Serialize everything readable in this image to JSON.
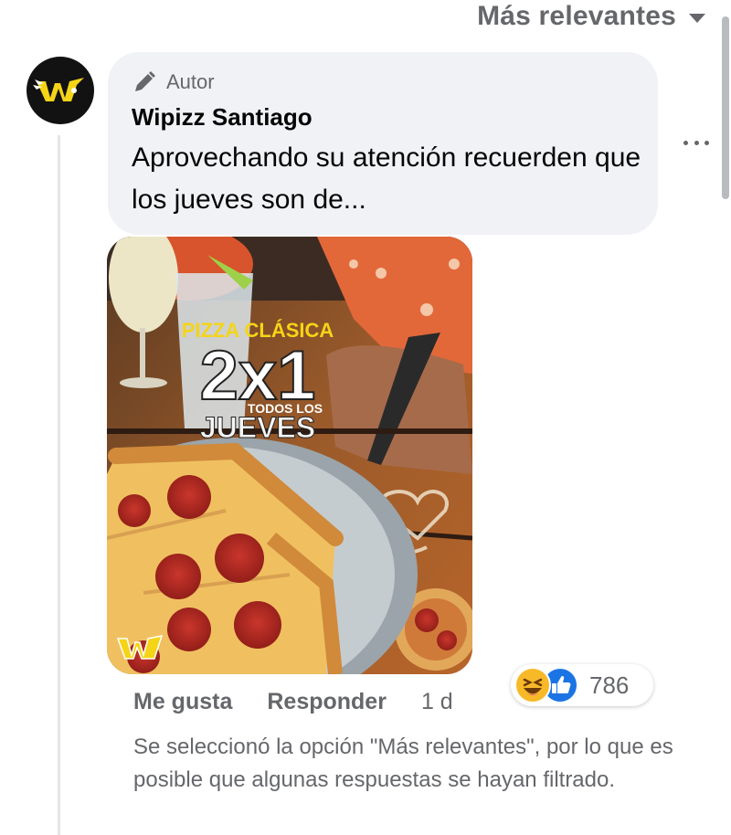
{
  "sort": {
    "label": "Más relevantes",
    "icon": "caret-down-icon"
  },
  "comment": {
    "avatar_icon": "wipizz-logo-icon",
    "author_badge": "Autor",
    "author_name": "Wipizz Santiago",
    "text": "Aprovechando su atención recuerden que los jueves son de...",
    "photo": {
      "description_icon": "pizza-promo-image",
      "headline": "PIZZA CLÁSICA",
      "promo": "2x1",
      "subline": "TODOS LOS",
      "day": "JUEVES",
      "logo_text": "Wi pizz"
    },
    "actions": {
      "like": "Me gusta",
      "reply": "Responder",
      "time": "1 d"
    },
    "reactions": {
      "icons": [
        "haha-icon",
        "like-icon"
      ],
      "count": "786"
    }
  },
  "filter_note": "Se seleccionó la opción \"Más relevantes\", por lo que es posible que algunas respuestas se hayan filtrado.",
  "colors": {
    "secondary_text": "#65676b",
    "bubble_bg": "#f0f2f5",
    "like_blue": "#1b74e4",
    "haha_yellow": "#f7b928",
    "promo_yellow": "#f5d417"
  }
}
